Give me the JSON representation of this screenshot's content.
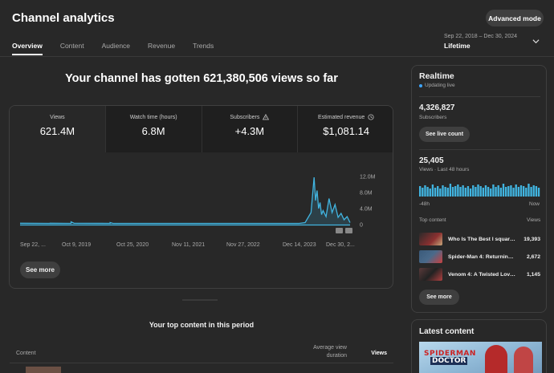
{
  "header": {
    "title": "Channel analytics",
    "advanced_mode": "Advanced mode",
    "tabs": [
      {
        "label": "Overview",
        "active": true
      },
      {
        "label": "Content",
        "active": false
      },
      {
        "label": "Audience",
        "active": false
      },
      {
        "label": "Revenue",
        "active": false
      },
      {
        "label": "Trends",
        "active": false
      }
    ],
    "date_range": "Sep 22, 2018 – Dec 30, 2024",
    "period": "Lifetime",
    "period_icon": "chevron-down-icon"
  },
  "overview": {
    "headline": "Your channel has gotten 621,380,506 views so far",
    "metrics": [
      {
        "label": "Views",
        "value": "621.4M",
        "icon": null,
        "active": true
      },
      {
        "label": "Watch time (hours)",
        "value": "6.8M",
        "icon": null,
        "active": false
      },
      {
        "label": "Subscribers",
        "value": "+4.3M",
        "icon": "warning-icon",
        "active": false
      },
      {
        "label": "Estimated revenue",
        "value": "$1,081.14",
        "icon": "clock-icon",
        "active": false
      }
    ],
    "see_more": "See more"
  },
  "chart_data": {
    "type": "area",
    "x_tick_labels": [
      "Sep 22, ...",
      "Oct 9, 2019",
      "Oct 25, 2020",
      "Nov 11, 2021",
      "Nov 27, 2022",
      "Dec 14, 2023",
      "Dec 30, 2..."
    ],
    "y_tick_labels": [
      "12.0M",
      "8.0M",
      "4.0M",
      "0"
    ],
    "ylim": [
      0,
      12000000
    ],
    "series_color": "#41b4e0",
    "series": [
      {
        "values": [
          [
            0.0,
            0.35
          ],
          [
            0.1,
            0.3
          ],
          [
            0.1,
            0.35
          ],
          [
            0.17,
            0.3
          ],
          [
            0.17,
            0.7
          ],
          [
            0.18,
            0.35
          ],
          [
            0.3,
            0.3
          ],
          [
            0.3,
            0.5
          ],
          [
            0.31,
            0.3
          ],
          [
            0.5,
            0.3
          ],
          [
            0.7,
            0.3
          ],
          [
            0.9,
            0.3
          ],
          [
            0.93,
            0.3
          ],
          [
            0.95,
            0.5
          ],
          [
            0.97,
            3.0
          ],
          [
            0.98,
            11.8
          ],
          [
            0.985,
            6.0
          ],
          [
            0.99,
            8.5
          ],
          [
            0.995,
            4.0
          ],
          [
            1.0,
            5.5
          ],
          [
            1.005,
            2.5
          ],
          [
            1.01,
            3.5
          ],
          [
            1.02,
            2.0
          ],
          [
            1.03,
            6.5
          ],
          [
            1.04,
            3.0
          ],
          [
            1.05,
            5.0
          ],
          [
            1.06,
            1.8
          ],
          [
            1.07,
            2.8
          ],
          [
            1.08,
            1.2
          ],
          [
            1.09,
            2.0
          ],
          [
            1.1,
            0.5
          ]
        ]
      }
    ],
    "note_units": "x is time fraction across the plotted period, y in millions of views"
  },
  "realtime": {
    "title": "Realtime",
    "status": "Updating live",
    "subscribers": "4,326,827",
    "subscribers_label": "Subscribers",
    "live_count_button": "See live count",
    "views": "25,405",
    "views_label": "Views · Last 48 hours",
    "bars": [
      0.65,
      0.55,
      0.7,
      0.6,
      0.5,
      0.75,
      0.55,
      0.65,
      0.5,
      0.7,
      0.6,
      0.55,
      0.8,
      0.6,
      0.65,
      0.75,
      0.6,
      0.7,
      0.55,
      0.65,
      0.5,
      0.7,
      0.6,
      0.75,
      0.65,
      0.55,
      0.7,
      0.6,
      0.5,
      0.75,
      0.6,
      0.7,
      0.55,
      0.8,
      0.6,
      0.65,
      0.7,
      0.55,
      0.75,
      0.6,
      0.7,
      0.65,
      0.55,
      0.8,
      0.6,
      0.7,
      0.65,
      0.55
    ],
    "axis_left": "-48h",
    "axis_right": "Now",
    "top_content_label": "Top content",
    "top_content_views_label": "Views",
    "top_content": [
      {
        "title": "Who Is The Best l square...",
        "views": "19,393",
        "thumb_color": "#8b3030"
      },
      {
        "title": "Spider-Man 4: Returning ...",
        "views": "2,672",
        "thumb_color": "#4a6a8a"
      },
      {
        "title": "Venom 4: A Twisted Love...",
        "views": "1,145",
        "thumb_color": "#5a3a3a"
      }
    ],
    "see_more": "See more"
  },
  "top_content": {
    "title": "Your top content in this period",
    "col_content": "Content",
    "col_avd": "Average view duration",
    "col_views": "Views"
  },
  "latest": {
    "title": "Latest content",
    "thumb_text_1": "SPIDERMAN",
    "thumb_text_2": "DOCTOR"
  }
}
